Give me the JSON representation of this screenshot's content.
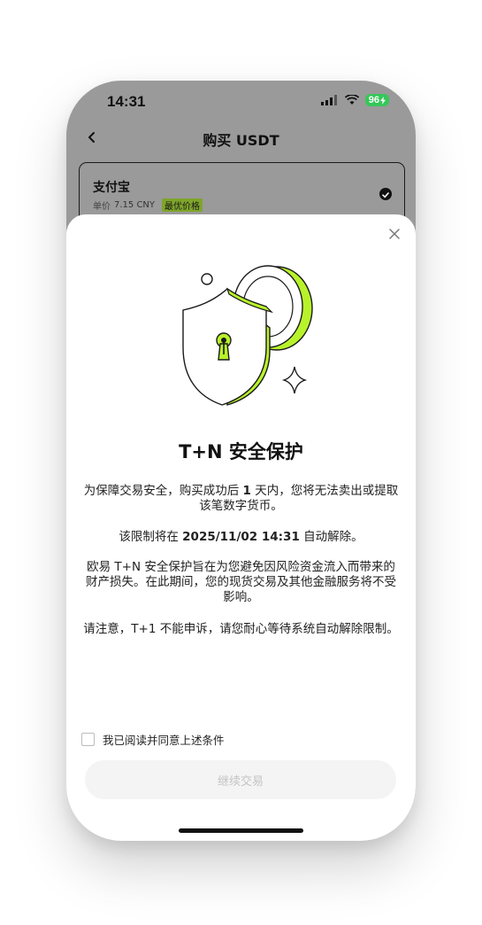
{
  "status": {
    "time": "14:31",
    "battery": "96"
  },
  "nav": {
    "title": "购买 USDT"
  },
  "payment": {
    "method": "支付宝",
    "price_label": "单价",
    "price_value": "7.15 CNY",
    "badge": "最优价格"
  },
  "modal": {
    "title": "T+N 安全保护",
    "p1_a": "为保障交易安全，购买成功后 ",
    "p1_b": "1",
    "p1_c": " 天内，您将无法卖出或提取该笔数字货币。",
    "p2_a": "该限制将在 ",
    "p2_b": "2025/11/02 14:31",
    "p2_c": " 自动解除。",
    "p3": "欧易 T+N 安全保护旨在为您避免因风险资金流入而带来的财产损失。在此期间，您的现货交易及其他金融服务将不受影响。",
    "p4": "请注意，T+1 不能申诉，请您耐心等待系统自动解除限制。",
    "agree_label": "我已阅读并同意上述条件",
    "continue_label": "继续交易"
  },
  "colors": {
    "accent": "#b8f22b",
    "overlay": "#9a9a9a",
    "battery": "#35c759"
  }
}
